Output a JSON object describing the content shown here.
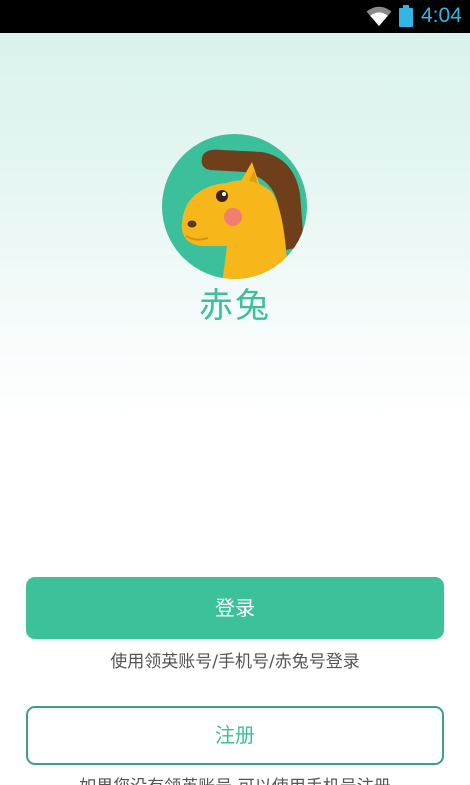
{
  "status_bar": {
    "time": "4:04",
    "icons": [
      "wifi-icon",
      "battery-icon"
    ],
    "accent_color": "#33b5e5"
  },
  "app": {
    "name": "赤兔",
    "logo_icon": "horse-logo-icon",
    "brand_color": "#3cc19b"
  },
  "actions": {
    "login_label": "登录",
    "login_hint": "使用领英账号/手机号/赤兔号登录",
    "register_label": "注册",
    "register_hint": "如果您没有领英账号,可以使用手机号注册"
  }
}
